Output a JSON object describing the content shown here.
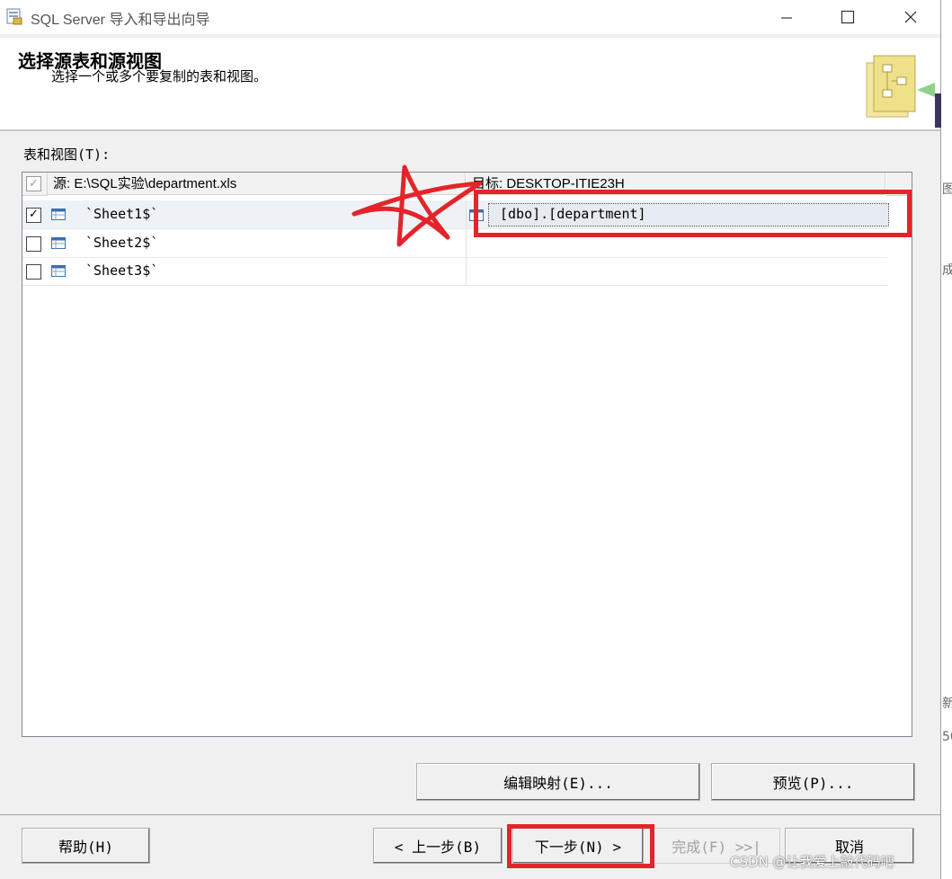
{
  "window": {
    "title": "SQL Server 导入和导出向导",
    "minimize_icon": "minimize-icon",
    "maximize_icon": "maximize-icon",
    "close_icon": "close-icon"
  },
  "header": {
    "title": "选择源表和源视图",
    "subtitle": "选择一个或多个要复制的表和视图。"
  },
  "tables_label": "表和视图(T):",
  "grid": {
    "source_header": "源: E:\\SQL实验\\department.xls",
    "dest_header": "目标: DESKTOP-ITIE23H",
    "rows": [
      {
        "checked": true,
        "source": "`Sheet1$`",
        "destination": "[dbo].[department]"
      },
      {
        "checked": false,
        "source": "`Sheet2$`",
        "destination": ""
      },
      {
        "checked": false,
        "source": "`Sheet3$`",
        "destination": ""
      }
    ]
  },
  "buttons": {
    "edit_mappings": "编辑映射(E)...",
    "preview": "预览(P)...",
    "help": "帮助(H)",
    "back": "< 上一步(B)",
    "next": "下一步(N) >",
    "finish": "完成(F) >>|",
    "cancel": "取消"
  },
  "edge_fragments": [
    "图",
    "成",
    "新",
    "50"
  ],
  "watermark": "CSDN @让我爱上敲代码吧",
  "colors": {
    "annotation_red": "#e3242b"
  }
}
